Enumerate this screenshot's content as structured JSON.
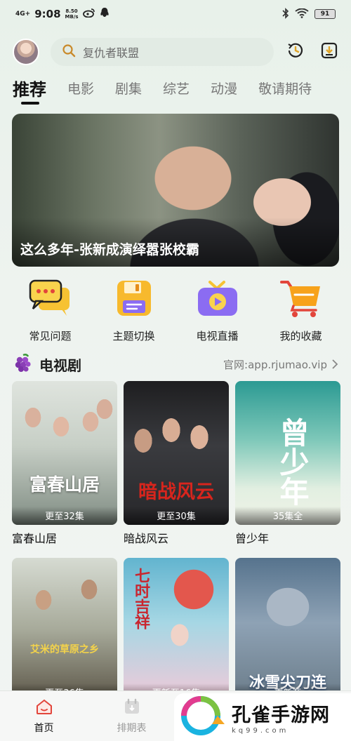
{
  "status_bar": {
    "network": "4G+",
    "time": "9:08",
    "speed_value": "8.50",
    "speed_unit": "MB/s",
    "battery": "91"
  },
  "header": {
    "search_placeholder": "复仇者联盟"
  },
  "tabs": [
    {
      "label": "推荐",
      "active": true
    },
    {
      "label": "电影"
    },
    {
      "label": "剧集"
    },
    {
      "label": "综艺"
    },
    {
      "label": "动漫"
    },
    {
      "label": "敬请期待"
    }
  ],
  "banner": {
    "caption": "这么多年-张新成演绎嚣张校霸"
  },
  "quick_menu": [
    {
      "label": "常见问题",
      "icon": "chat-bubbles-icon"
    },
    {
      "label": "主题切换",
      "icon": "save-disk-icon"
    },
    {
      "label": "电视直播",
      "icon": "tv-icon"
    },
    {
      "label": "我的收藏",
      "icon": "cart-icon"
    }
  ],
  "section": {
    "title": "电视剧",
    "link": "官网:app.rjumao.vip"
  },
  "cards": [
    {
      "title": "富春山居",
      "badge": "更至32集",
      "art": "富春山居"
    },
    {
      "title": "暗战风云",
      "badge": "更至30集",
      "art": "暗战风云"
    },
    {
      "title": "曾少年",
      "badge": "35集全",
      "art": "曾少年"
    },
    {
      "title": "",
      "badge": "更至36集",
      "art": "艾米的草原之乡"
    },
    {
      "title": "",
      "badge": "更新至16集",
      "art": "七时吉祥"
    },
    {
      "title": "",
      "badge": "更新至",
      "art": "冰雪尖刀连"
    }
  ],
  "bottom_nav": [
    {
      "label": "首页",
      "active": true
    },
    {
      "label": "排期表"
    }
  ],
  "watermark": {
    "title": "孔雀手游网",
    "url": "kq99.com"
  },
  "colors": {
    "accent_red": "#e2453b",
    "quick_yellow": "#f6c233",
    "quick_purple": "#7a5cf0",
    "quick_orange": "#f7a21b"
  }
}
